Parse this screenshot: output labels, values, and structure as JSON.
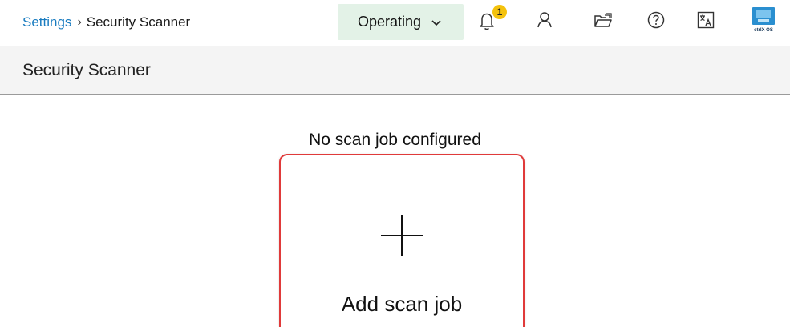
{
  "breadcrumb": {
    "parent": "Settings",
    "separator": "›",
    "current": "Security Scanner"
  },
  "header": {
    "state_label": "Operating",
    "notification_count": "1",
    "icons": [
      "bell-icon",
      "user-icon",
      "folder-icon",
      "help-icon",
      "translate-icon",
      "ctrlx-os-logo-icon"
    ],
    "logo_text": "ctrlX OS"
  },
  "subheader": {
    "title": "Security Scanner"
  },
  "main": {
    "empty_message": "No scan job configured",
    "add_button_label": "Add scan job"
  },
  "colors": {
    "link": "#1a7cc0",
    "operating_bg": "#e3f2e7",
    "badge": "#f4c20d",
    "highlight": "#e03a3a"
  }
}
